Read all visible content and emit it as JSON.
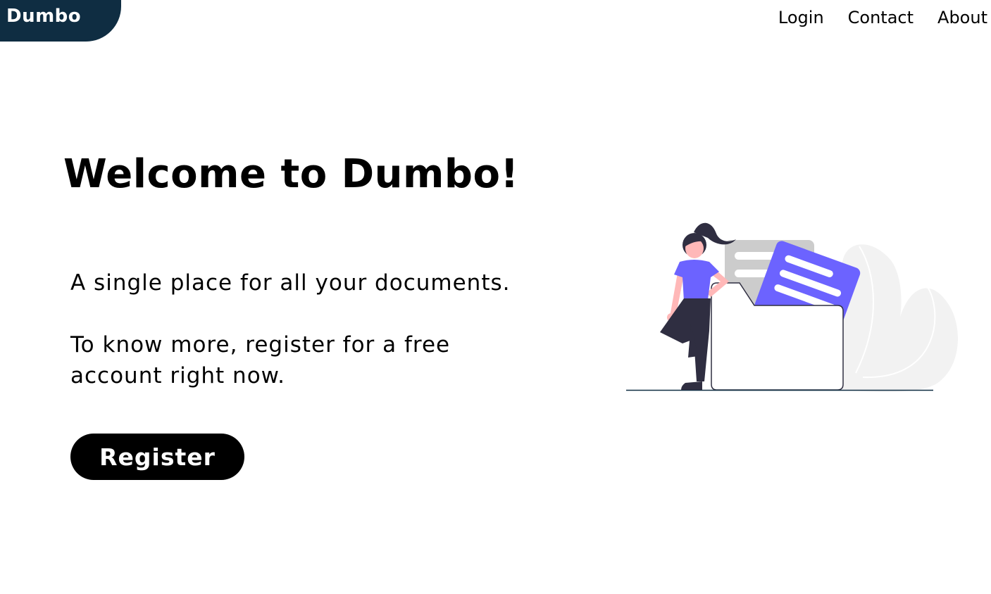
{
  "brand": {
    "name": "Dumbo",
    "color": "#0f2d42"
  },
  "nav": {
    "items": [
      {
        "label": "Login"
      },
      {
        "label": "Contact"
      },
      {
        "label": "About"
      }
    ]
  },
  "hero": {
    "title": "Welcome to Dumbo!",
    "tagline": "A single place for all your documents.",
    "cta_text": "To know more, register for a free account right now.",
    "register_label": "Register"
  },
  "illustration": {
    "subject": "woman-with-documents-folder",
    "accent_color": "#6c63ff",
    "skin_color": "#ffb8b8",
    "dark_color": "#2f2e41"
  }
}
